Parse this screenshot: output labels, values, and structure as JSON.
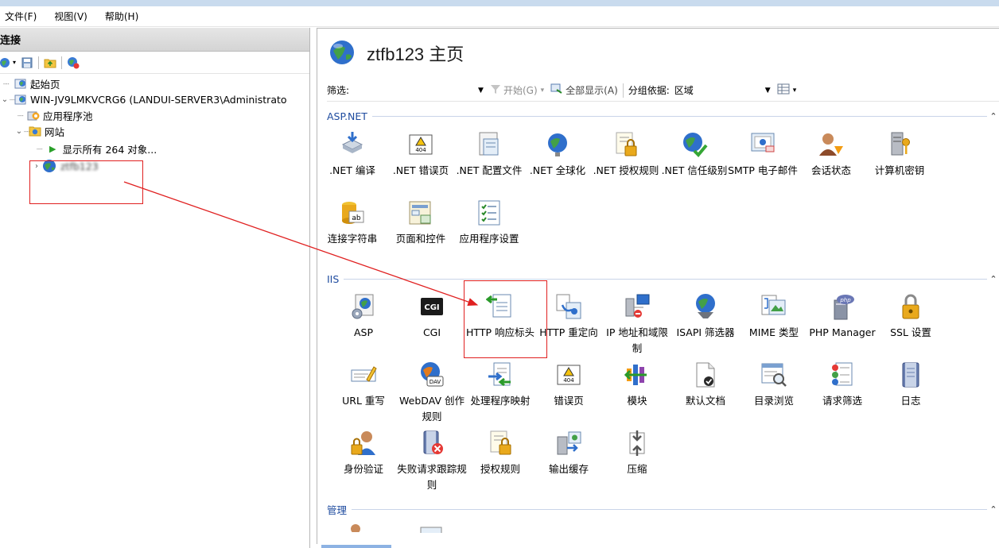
{
  "menu": [
    "文件(F)",
    "视图(V)",
    "帮助(H)"
  ],
  "connections": {
    "header": "连接",
    "tree": {
      "start_page": "起始页",
      "server": "WIN-JV9LMKVCRG6 (LANDUI-SERVER3\\Administrato",
      "app_pools": "应用程序池",
      "sites": "网站",
      "show_all": "显示所有 264 对象...",
      "site_blurred": "ztfb123"
    }
  },
  "main": {
    "title": "ztfb123 主页",
    "filter": {
      "label": "筛选:",
      "start_label": "开始(G)",
      "show_all_label": "全部显示(A)",
      "group_label": "分组依据:",
      "group_value": "区域"
    },
    "sections": {
      "aspnet": "ASP.NET",
      "iis": "IIS",
      "manage": "管理"
    },
    "aspnet_features": [
      ".NET 编译",
      ".NET 错误页",
      ".NET 配置文件",
      ".NET 全球化",
      ".NET 授权规则",
      ".NET 信任级别",
      "SMTP 电子邮件",
      "会话状态",
      "计算机密钥",
      "连接字符串",
      "页面和控件",
      "应用程序设置"
    ],
    "iis_features": [
      "ASP",
      "CGI",
      "HTTP 响应标头",
      "HTTP 重定向",
      "IP 地址和域限制",
      "ISAPI 筛选器",
      "MIME 类型",
      "PHP Manager",
      "SSL 设置",
      "URL 重写",
      "WebDAV 创作规则",
      "处理程序映射",
      "错误页",
      "模块",
      "默认文档",
      "目录浏览",
      "请求筛选",
      "日志",
      "身份验证",
      "失败请求跟踪规则",
      "授权规则",
      "输出缓存",
      "压缩"
    ],
    "icon_texts": {
      "error_404": "404",
      "cgi": "CGI",
      "ab": "ab",
      "php": "php",
      "dav": "DAV"
    }
  }
}
